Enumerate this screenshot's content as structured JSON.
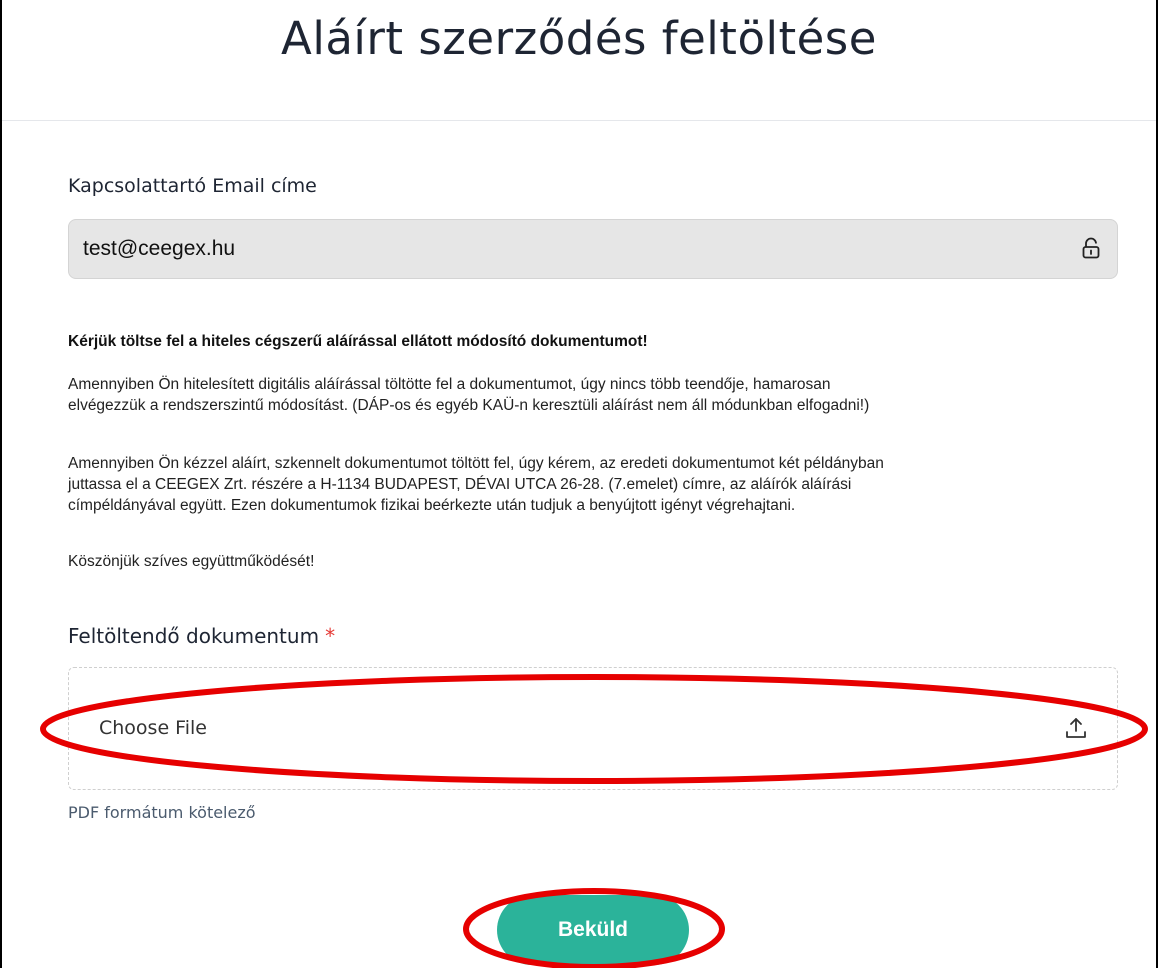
{
  "page": {
    "title": "Aláírt szerződés feltöltése"
  },
  "email": {
    "label": "Kapcsolattartó Email címe",
    "value": "test@ceegex.hu",
    "icon": "lock-icon"
  },
  "notice": {
    "heading": "Kérjük töltse fel a hiteles cégszerű aláírással ellátott módosító dokumentumot!",
    "paragraph1_line1": "Amennyiben Ön hitelesített digitális aláírással töltötte fel a dokumentumot, úgy nincs több teendője, hamarosan",
    "paragraph1_line2": "elvégezzük a rendszerszintű módosítást. (DÁP-os és egyéb KAÜ-n keresztüli aláírást nem áll módunkban elfogadni!)",
    "paragraph2_line1": "Amennyiben Ön kézzel aláírt, szkennelt dokumentumot töltött fel, úgy kérem, az eredeti dokumentumot két példányban",
    "paragraph2_line2": "juttassa el a CEEGEX Zrt. részére a H-1134 BUDAPEST, DÉVAI UTCA 26-28. (7.emelet) címre, az aláírók aláírási",
    "paragraph2_line3": "címpéldányával együtt. Ezen dokumentumok fizikai beérkezte után tudjuk a benyújtott igényt végrehajtani.",
    "thanks": "Köszönjük szíves együttműködését!"
  },
  "upload": {
    "label": "Feltöltendő dokumentum",
    "required_mark": "*",
    "button_label": "Choose File",
    "icon": "upload-icon",
    "hint": "PDF formátum kötelező"
  },
  "submit": {
    "label": "Beküld"
  },
  "colors": {
    "accent": "#2bb39a",
    "annotation": "#e60000",
    "required": "#e53935"
  }
}
